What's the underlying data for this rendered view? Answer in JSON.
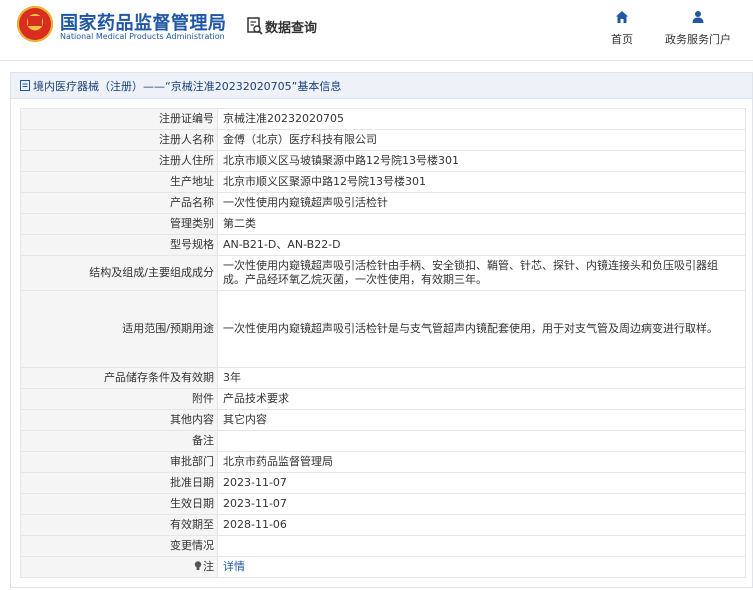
{
  "header": {
    "logo_cn": "国家药品监督管理局",
    "logo_en": "National Medical Products Administration",
    "query_label": "数据查询",
    "nav": [
      {
        "label": "首页",
        "icon": "home-icon"
      },
      {
        "label": "政务服务门户",
        "icon": "user-icon"
      }
    ]
  },
  "panel": {
    "title": "境内医疗器械（注册）——“京械注准20232020705”基本信息"
  },
  "rows": [
    {
      "key": "注册证编号",
      "value": "京械注准20232020705"
    },
    {
      "key": "注册人名称",
      "value": "金傅（北京）医疗科技有限公司"
    },
    {
      "key": "注册人住所",
      "value": "北京市顺义区马坡镇聚源中路12号院13号楼301"
    },
    {
      "key": "生产地址",
      "value": "北京市顺义区聚源中路12号院13号楼301"
    },
    {
      "key": "产品名称",
      "value": "一次性使用内窥镜超声吸引活检针"
    },
    {
      "key": "管理类别",
      "value": "第二类"
    },
    {
      "key": "型号规格",
      "value": "AN-B21-D、AN-B22-D"
    },
    {
      "key": "结构及组成/主要组成成分",
      "value": "一次性使用内窥镜超声吸引活检针由手柄、安全锁扣、鞘管、针芯、探针、内镜连接头和负压吸引器组成。产品经环氧乙烷灭菌，一次性使用，有效期三年。"
    },
    {
      "key": "适用范围/预期用途",
      "value": "一次性使用内窥镜超声吸引活检针是与支气管超声内镜配套使用，用于对支气管及周边病变进行取样。"
    },
    {
      "key": "产品储存条件及有效期",
      "value": "3年"
    },
    {
      "key": "附件",
      "value": "产品技术要求"
    },
    {
      "key": "其他内容",
      "value": "其它内容"
    },
    {
      "key": "备注",
      "value": ""
    },
    {
      "key": "审批部门",
      "value": "北京市药品监督管理局"
    },
    {
      "key": "批准日期",
      "value": "2023-11-07"
    },
    {
      "key": "生效日期",
      "value": "2023-11-07"
    },
    {
      "key": "有效期至",
      "value": "2028-11-06"
    },
    {
      "key": "变更情况",
      "value": ""
    },
    {
      "key": "注",
      "value": "详情"
    }
  ],
  "colors": {
    "brand_blue": "#1f57a4",
    "title_bar_bg": "#eef2f8",
    "key_cell_bg": "#f5f5f5",
    "border": "#e6e6e6"
  }
}
